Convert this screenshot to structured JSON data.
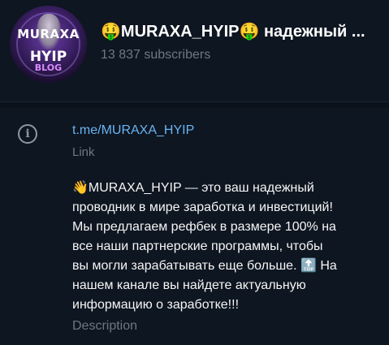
{
  "channel": {
    "avatar_text": {
      "top": "MURAXA",
      "middle": "HYIP",
      "bottom": "BLOG"
    },
    "title": "🤑MURAXA_HYIP🤑 надежный ...",
    "subscribers": "13 837 subscribers"
  },
  "info": {
    "icon": "info-icon",
    "link": "t.me/MURAXA_HYIP",
    "link_label": "Link",
    "description_lines": [
      "👋MURAXA_HYIP — это ваш надежный",
      "проводник в мире заработка и инвестиций!",
      "Мы предлагаем рефбек в размере 100% на",
      "все наши партнерские программы, чтобы",
      "вы могли зарабатывать еще больше. 🔝 На",
      "нашем канале вы найдете актуальную",
      "информацию о заработке!!!"
    ],
    "description_label": "Description"
  },
  "colors": {
    "background": "#0e1621",
    "link": "#6ab3f3",
    "muted": "#6d7883"
  }
}
